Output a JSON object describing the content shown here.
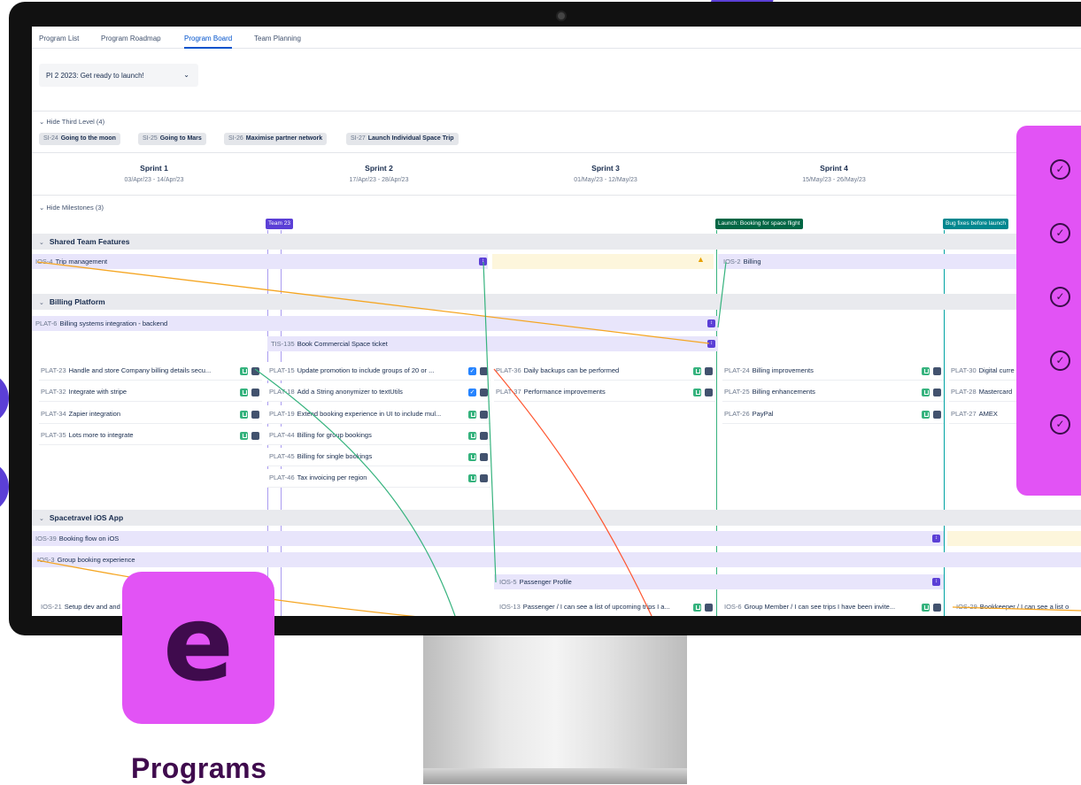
{
  "tabs": [
    "Program List",
    "Program Roadmap",
    "Program Board",
    "Team Planning"
  ],
  "active_tab": "Program Board",
  "pi_select": {
    "value": "PI 2 2023: Get ready to launch!"
  },
  "third_level_toggle": "Hide Third Level (4)",
  "third_level_chips": [
    {
      "key": "SI-24",
      "name": "Going to the moon"
    },
    {
      "key": "SI-25",
      "name": "Going to Mars"
    },
    {
      "key": "SI-26",
      "name": "Maximise partner network"
    },
    {
      "key": "SI-27",
      "name": "Launch Individual Space Trip"
    }
  ],
  "sprints": [
    {
      "name": "Sprint 1",
      "dates": "03/Apr/23 - 14/Apr/23"
    },
    {
      "name": "Sprint 2",
      "dates": "17/Apr/23 - 28/Apr/23"
    },
    {
      "name": "Sprint 3",
      "dates": "01/May/23 - 12/May/23"
    },
    {
      "name": "Sprint 4",
      "dates": "15/May/23 - 26/May/23"
    }
  ],
  "milestones_toggle": "Hide Milestones (3)",
  "milestones": [
    {
      "label": "Team 23",
      "color": "#5b3fd6"
    },
    {
      "label": "Launch: Booking for space flight",
      "color": "#006644"
    },
    {
      "label": "Bug fixes before launch",
      "color": "#00878f"
    }
  ],
  "groups": {
    "shared": "Shared Team Features",
    "billing": "Billing Platform",
    "ios": "Spacetravel iOS App"
  },
  "features": {
    "ios4": {
      "key": "IOS-4",
      "name": "Trip management"
    },
    "ios2": {
      "key": "IOS-2",
      "name": "Billing"
    },
    "plat6": {
      "key": "PLAT-6",
      "name": "Billing systems integration - backend"
    },
    "tis135": {
      "key": "TIS-135",
      "name": "Book Commercial Space ticket"
    },
    "ios39": {
      "key": "IOS-39",
      "name": "Booking flow on iOS"
    },
    "ios3": {
      "key": "IOS-3",
      "name": "Group booking experience"
    },
    "ios5": {
      "key": "IOS-5",
      "name": "Passenger Profile"
    }
  },
  "cards": {
    "c1": {
      "key": "PLAT-23",
      "name": "Handle and store Company billing details secu..."
    },
    "c2": {
      "key": "PLAT-32",
      "name": "Integrate with stripe"
    },
    "c3": {
      "key": "PLAT-34",
      "name": "Zapier integration"
    },
    "c4": {
      "key": "PLAT-35",
      "name": "Lots more to integrate"
    },
    "c5": {
      "key": "PLAT-15",
      "name": "Update promotion to include groups of 20 or ..."
    },
    "c6": {
      "key": "PLAT-18",
      "name": "Add a String anonymizer to textUtils"
    },
    "c7": {
      "key": "PLAT-19",
      "name": "Extend booking experience in UI to include mul..."
    },
    "c8": {
      "key": "PLAT-44",
      "name": "Billing for group bookings"
    },
    "c9": {
      "key": "PLAT-45",
      "name": "Billing for single bookings"
    },
    "c10": {
      "key": "PLAT-46",
      "name": "Tax invoicing per region"
    },
    "c11": {
      "key": "PLAT-36",
      "name": "Daily backups can be performed"
    },
    "c12": {
      "key": "PLAT-37",
      "name": "Performance improvements"
    },
    "c13": {
      "key": "PLAT-24",
      "name": "Billing improvements"
    },
    "c14": {
      "key": "PLAT-25",
      "name": "Billing enhancements"
    },
    "c15": {
      "key": "PLAT-26",
      "name": "PayPal"
    },
    "c16": {
      "key": "PLAT-30",
      "name": "Digital curre"
    },
    "c17": {
      "key": "PLAT-28",
      "name": "Mastercard"
    },
    "c18": {
      "key": "PLAT-27",
      "name": "AMEX"
    },
    "c19": {
      "key": "IOS-21",
      "name": "Setup dev and and"
    },
    "c20": {
      "key": "IOS-13",
      "name": "Passenger / I can see a list of upcoming trips I a..."
    },
    "c21": {
      "key": "IOS-6",
      "name": "Group Member / I can see trips I have been invite..."
    },
    "c22": {
      "key": "IOS-29",
      "name": "Bookkeeper / I can see a list o"
    }
  },
  "colors": {
    "accent": "#e253f5",
    "brand_dark": "#3f0b4d",
    "link": "#0052cc",
    "purple": "#5b3fd6"
  },
  "brand": {
    "name": "Programs",
    "logo_letter": "e"
  }
}
